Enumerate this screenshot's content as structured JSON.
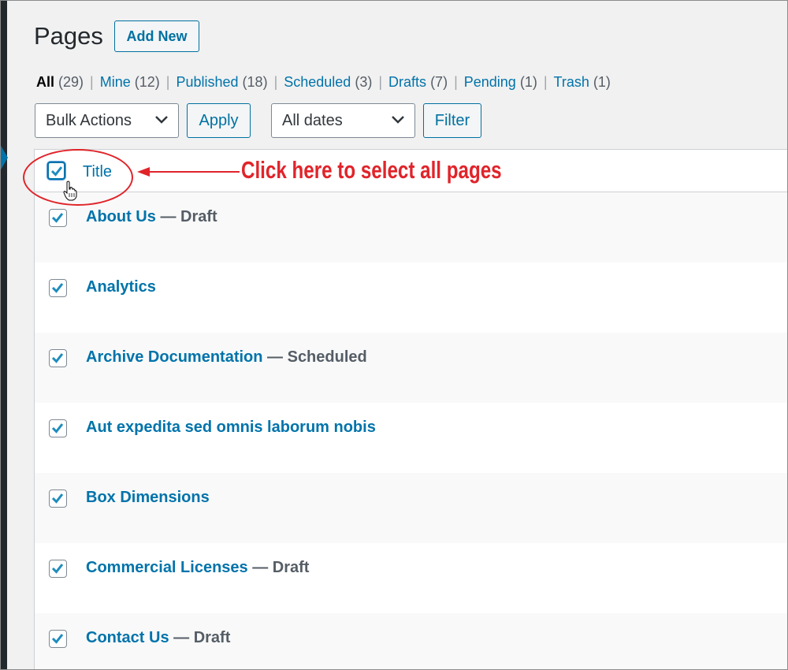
{
  "page": {
    "title": "Pages",
    "add_new_label": "Add New"
  },
  "filters": [
    {
      "label": "All",
      "count": "(29)",
      "current": true
    },
    {
      "label": "Mine",
      "count": "(12)"
    },
    {
      "label": "Published",
      "count": "(18)"
    },
    {
      "label": "Scheduled",
      "count": "(3)"
    },
    {
      "label": "Drafts",
      "count": "(7)"
    },
    {
      "label": "Pending",
      "count": "(1)"
    },
    {
      "label": "Trash",
      "count": "(1)"
    }
  ],
  "filter_separator": "|",
  "toolbar": {
    "bulk_actions_value": "Bulk Actions",
    "apply_label": "Apply",
    "dates_value": "All dates",
    "filter_label": "Filter"
  },
  "table": {
    "title_column": "Title",
    "rows": [
      {
        "title": "About Us",
        "state": " — Draft"
      },
      {
        "title": "Analytics",
        "state": ""
      },
      {
        "title": "Archive Documentation",
        "state": " — Scheduled"
      },
      {
        "title": "Aut expedita sed omnis laborum nobis",
        "state": ""
      },
      {
        "title": "Box Dimensions",
        "state": ""
      },
      {
        "title": "Commercial Licenses",
        "state": " — Draft"
      },
      {
        "title": "Contact Us",
        "state": " — Draft"
      }
    ]
  },
  "annotation": {
    "text": "Click here to select all pages",
    "color": "#e0242a"
  },
  "colors": {
    "link": "#0073aa",
    "sidebar": "#23282d",
    "background": "#f1f1f1"
  }
}
